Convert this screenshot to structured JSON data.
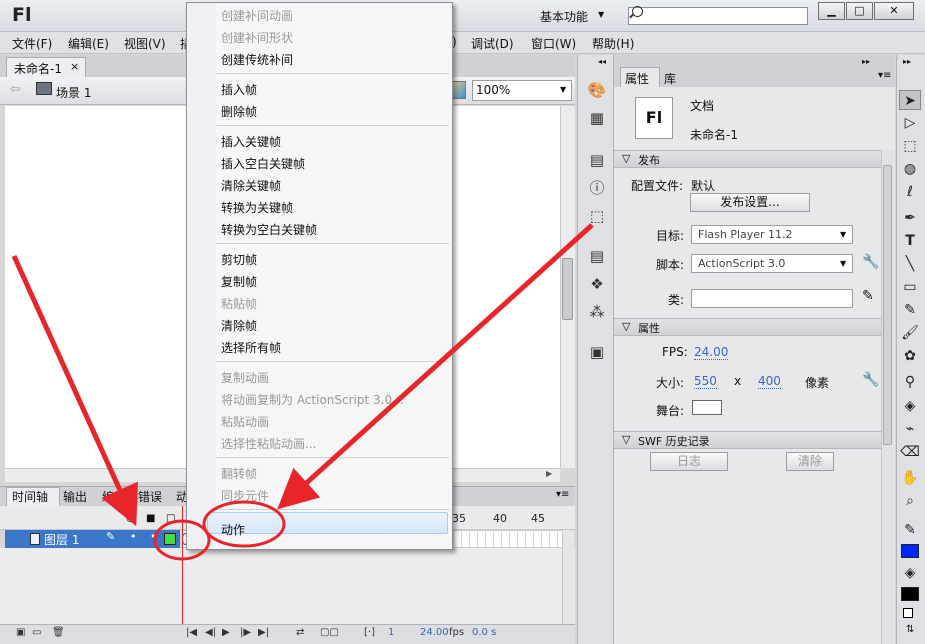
{
  "app": {
    "logo": "Fl",
    "workspace_label": "基本功能",
    "search_placeholder": ""
  },
  "window_buttons": {
    "minimize": "▁",
    "maximize": "□",
    "close": "✕"
  },
  "menubar": {
    "left_items": [
      "文件(F)",
      "编辑(E)",
      "视图(V)",
      "插"
    ],
    "right_items": [
      ")",
      "调试(D)",
      "窗口(W)",
      "帮助(H)"
    ]
  },
  "document": {
    "tab_name": "未命名-1",
    "tab_close": "×",
    "scene_label": "场景 1",
    "zoom": "100%"
  },
  "context_menu": {
    "groups": [
      [
        {
          "label": "创建补间动画",
          "enabled": false
        },
        {
          "label": "创建补间形状",
          "enabled": false
        },
        {
          "label": "创建传统补间",
          "enabled": true
        }
      ],
      [
        {
          "label": "插入帧",
          "enabled": true
        },
        {
          "label": "删除帧",
          "enabled": true
        }
      ],
      [
        {
          "label": "插入关键帧",
          "enabled": true
        },
        {
          "label": "插入空白关键帧",
          "enabled": true
        },
        {
          "label": "清除关键帧",
          "enabled": true
        },
        {
          "label": "转换为关键帧",
          "enabled": true
        },
        {
          "label": "转换为空白关键帧",
          "enabled": true
        }
      ],
      [
        {
          "label": "剪切帧",
          "enabled": true
        },
        {
          "label": "复制帧",
          "enabled": true
        },
        {
          "label": "粘贴帧",
          "enabled": false
        },
        {
          "label": "清除帧",
          "enabled": true
        },
        {
          "label": "选择所有帧",
          "enabled": true
        }
      ],
      [
        {
          "label": "复制动画",
          "enabled": false
        },
        {
          "label": "将动画复制为 ActionScript 3.0...",
          "enabled": false
        },
        {
          "label": "粘贴动画",
          "enabled": false
        },
        {
          "label": "选择性粘贴动画...",
          "enabled": false
        }
      ],
      [
        {
          "label": "翻转帧",
          "enabled": false
        },
        {
          "label": "同步元件",
          "enabled": false
        }
      ],
      [
        {
          "label": "动作",
          "enabled": true,
          "highlighted": true
        }
      ]
    ]
  },
  "timeline": {
    "tabs": [
      "时间轴",
      "输出",
      "编译器错误",
      "动"
    ],
    "frame_numbers": [
      "35",
      "40",
      "45"
    ],
    "layer_name": "图层 1",
    "footer": {
      "frame": "1",
      "fps": "24.00",
      "fps_unit": "fps",
      "time": "0.0 s"
    }
  },
  "properties": {
    "tabs": [
      "属性",
      "库"
    ],
    "doc_icon": "Fl",
    "doc_type": "文档",
    "doc_name": "未命名-1",
    "publish_section": "发布",
    "profile_label": "配置文件:",
    "profile_value": "默认",
    "publish_settings_button": "发布设置...",
    "target_label": "目标:",
    "target_value": "Flash Player 11.2",
    "script_label": "脚本:",
    "script_value": "ActionScript 3.0",
    "class_label": "类:",
    "class_value": "",
    "properties_section": "属性",
    "fps_label": "FPS:",
    "fps_value": "24.00",
    "size_label": "大小:",
    "width": "550",
    "times": "x",
    "height": "400",
    "unit": "像素",
    "stage_label": "舞台:",
    "stage_color": "#FFFFFF",
    "swf_section": "SWF 历史记录",
    "log_button": "日志",
    "clear_button": "清除"
  },
  "colors": {
    "annotation_red": "#E8262A",
    "layer_selected": "#3B76C8",
    "layer_swatch": "#44DD44",
    "menu_highlight": "#D4E7FB",
    "link_blue": "#3B66C5"
  },
  "icons": {
    "strip": [
      "palette-icon",
      "grid-icon",
      "align-icon",
      "info-icon",
      "transform-icon",
      "code-snippets-icon",
      "components-icon",
      "motion-presets-icon",
      "scene-icon"
    ],
    "tools": [
      "selection-tool-icon",
      "subselection-tool-icon",
      "free-transform-icon",
      "3d-rotation-icon",
      "lasso-icon",
      "pen-icon",
      "text-icon",
      "line-icon",
      "rectangle-icon",
      "pencil-icon",
      "brush-icon",
      "deco-icon",
      "bone-icon",
      "paint-bucket-icon",
      "eyedropper-icon",
      "eraser-icon",
      "hand-icon",
      "zoom-icon",
      "stroke-color-icon",
      "fill-color-icon"
    ]
  }
}
